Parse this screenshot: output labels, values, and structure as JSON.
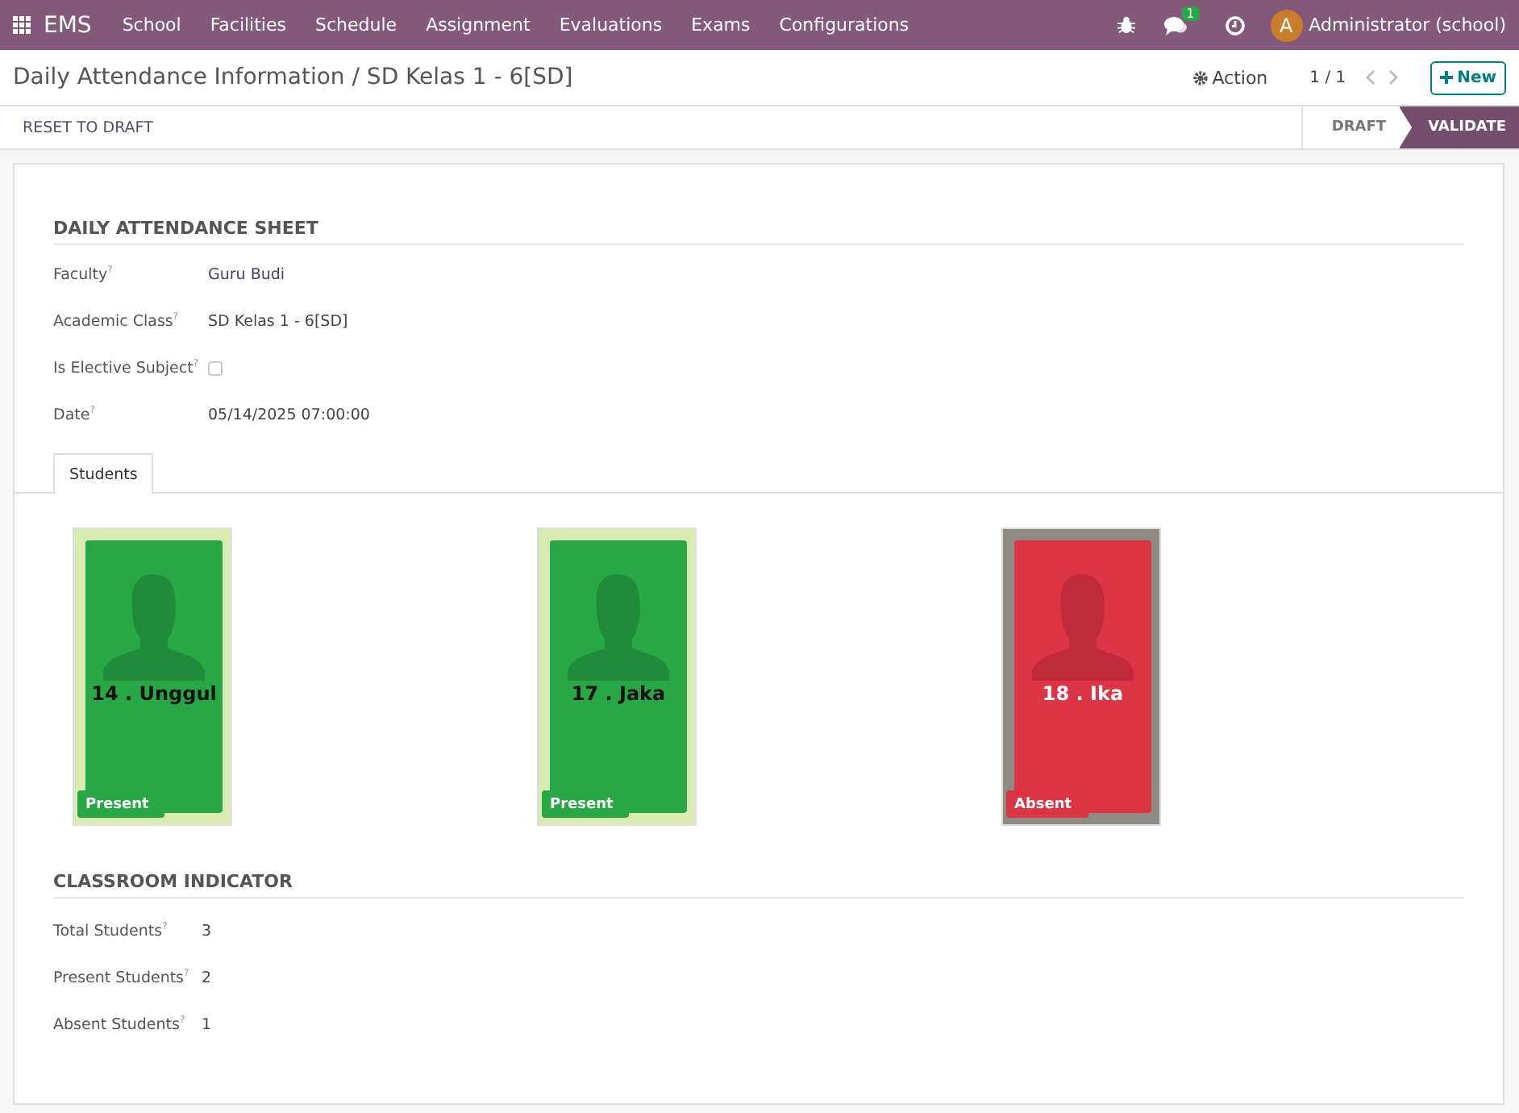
{
  "navbar": {
    "app": "EMS",
    "menus": [
      "School",
      "Facilities",
      "Schedule",
      "Assignment",
      "Evaluations",
      "Exams",
      "Configurations"
    ],
    "chat_count": "1",
    "avatar": "A",
    "user": "Administrator (school)"
  },
  "breadcrumb": "Daily Attendance Information / SD Kelas 1 - 6[SD]",
  "action": "Action",
  "pager": "1 / 1",
  "new_button": "New",
  "header_button": "RESET TO DRAFT",
  "stages": [
    {
      "label": "DRAFT",
      "selected": false
    },
    {
      "label": "VALIDATE",
      "selected": true
    }
  ],
  "sheet": {
    "title": "DAILY ATTENDANCE SHEET",
    "fields": [
      {
        "kind": "link",
        "label": "Faculty$^{?}$",
        "value": "Guru Budi"
      },
      {
        "kind": "text",
        "label": "Academic Class$^{?}$",
        "value": "SD Kelas 1 - 6[SD]"
      },
      {
        "kind": "checkbox",
        "label": "Is Elective Subject$^{?}$",
        "checked": false
      },
      {
        "kind": "text",
        "label": "Date$^{?}$",
        "value": "05/14/2025 07:00:00"
      }
    ],
    "tabs": [
      {
        "label": "Students",
        "selected": true
      }
    ],
    "students": [
      {
        "name": "14 . Unggul",
        "status": "Present",
        "kind": "present"
      },
      {
        "name": "17 . Jaka",
        "status": "Present",
        "kind": "present"
      },
      {
        "name": "18 . Ika",
        "status": "Absent",
        "kind": "absent"
      }
    ],
    "indicator_title": "CLASSROOM INDICATOR",
    "indicators": [
      {
        "label": "Total Students$^{?}$",
        "value": "3"
      },
      {
        "label": "Present Students$^{?}$",
        "value": "2"
      },
      {
        "label": "Absent Students$^{?}$",
        "value": "1"
      }
    ]
  }
}
